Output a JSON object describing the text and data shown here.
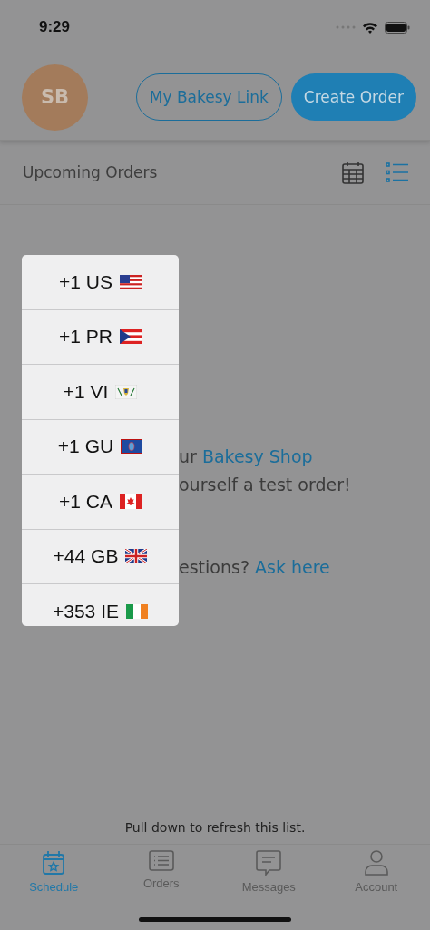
{
  "status_bar": {
    "time": "9:29"
  },
  "header": {
    "avatar_initials": "SB",
    "link_button": "My Bakesy Link",
    "primary_button": "Create Order"
  },
  "subheader": {
    "title": "Upcoming Orders",
    "views": [
      {
        "kind": "calendar",
        "selected": false
      },
      {
        "kind": "list",
        "selected": true
      }
    ]
  },
  "empty_state": {
    "lines": [
      "ur **Bakesy Shop**",
      "ourself a test order!",
      "estions? **Ask here**"
    ]
  },
  "country_menu": {
    "items": [
      {
        "label": "+1 US",
        "kind": "us"
      },
      {
        "label": "+1 PR",
        "kind": "pr"
      },
      {
        "label": "+1 VI",
        "kind": "vi"
      },
      {
        "label": "+1 GU",
        "kind": "gu"
      },
      {
        "label": "+1 CA",
        "kind": "ca"
      },
      {
        "label": "+44 GB",
        "kind": "gb"
      },
      {
        "label": "+353 IE",
        "kind": "ie"
      }
    ]
  },
  "refresh_hint": "Pull down to refresh this list.",
  "tab_bar": [
    {
      "label": "Schedule",
      "kind": "schedule",
      "selected": true
    },
    {
      "label": "Orders",
      "kind": "orders",
      "selected": false
    },
    {
      "label": "Messages",
      "kind": "messages",
      "selected": false
    },
    {
      "label": "Account",
      "kind": "account",
      "selected": false
    }
  ]
}
